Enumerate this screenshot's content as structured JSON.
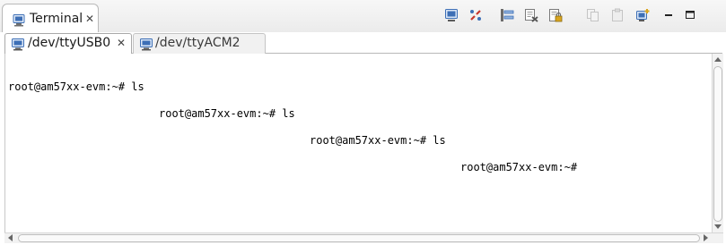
{
  "view": {
    "title": "Terminal",
    "title_icon": "terminal-view-icon",
    "close_glyph": "✕"
  },
  "toolbar": {
    "buttons": [
      {
        "name": "connect-icon",
        "enabled": true
      },
      {
        "name": "disconnect-icon",
        "enabled": true
      },
      {
        "name": "settings-icon",
        "enabled": true
      },
      {
        "name": "clear-console-icon",
        "enabled": true
      },
      {
        "name": "scroll-lock-icon",
        "enabled": true
      },
      {
        "name": "copy-icon",
        "enabled": false
      },
      {
        "name": "paste-icon",
        "enabled": false
      },
      {
        "name": "open-terminal-icon",
        "enabled": true
      },
      {
        "name": "minimize-icon",
        "enabled": true
      },
      {
        "name": "maximize-icon",
        "enabled": true
      }
    ]
  },
  "tabs": [
    {
      "label": "/dev/ttyUSB0",
      "active": true,
      "icon": "terminal-tab-icon",
      "close_glyph": "✕"
    },
    {
      "label": "/dev/ttyACM2",
      "active": false,
      "icon": "terminal-tab-icon"
    }
  ],
  "terminal": {
    "lines": [
      "root@am57xx-evm:~# ls",
      "root@am57xx-evm:~# ls",
      "root@am57xx-evm:~# ls",
      "root@am57xx-evm:~#"
    ]
  },
  "colors": {
    "header_bg": "#ebebeb",
    "icon_blue": "#3d6fb6",
    "icon_red": "#c8372d"
  }
}
